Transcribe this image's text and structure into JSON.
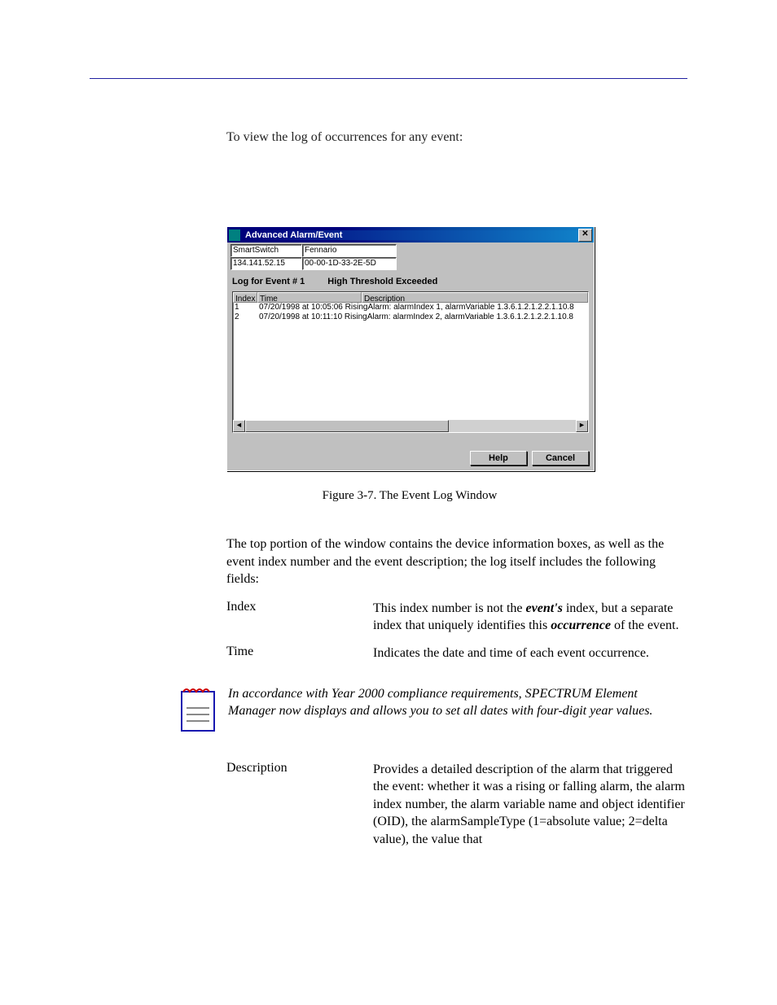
{
  "intro": "To view the log of occurrences for any event:",
  "window": {
    "title": "Advanced Alarm/Event",
    "info": {
      "device_name": "SmartSwitch",
      "location": "Fennario",
      "ip": "134.141.52.15",
      "mac": "00-00-1D-33-2E-5D"
    },
    "log_label": "Log for Event # 1",
    "log_desc": "High Threshold Exceeded",
    "columns": {
      "index": "Index",
      "time": "Time",
      "description": "Description"
    },
    "rows": [
      {
        "idx": "1",
        "rest": "07/20/1998 at 10:05:06  RisingAlarm: alarmIndex 1, alarmVariable 1.3.6.1.2.1.2.2.1.10.8"
      },
      {
        "idx": "2",
        "rest": "07/20/1998 at 10:11:10  RisingAlarm: alarmIndex 2, alarmVariable 1.3.6.1.2.1.2.2.1.10.8"
      }
    ],
    "buttons": {
      "help": "Help",
      "cancel": "Cancel"
    }
  },
  "figure_caption": "Figure 3-7. The Event Log Window",
  "para1": "The top portion of the window contains the device information boxes, as well as the event index number and the event description; the log itself includes the following fields:",
  "defs": {
    "index": {
      "term": "Index",
      "pre": "This index number is not the ",
      "em1": "event's",
      "mid": " index, but a separate index that uniquely identifies this ",
      "em2": "occurrence",
      "post": " of the event."
    },
    "time": {
      "term": "Time",
      "body": "Indicates the date and time of each event occurrence."
    },
    "description": {
      "term": "Description",
      "body": "Provides a detailed description of the alarm that triggered the event: whether it was a rising or falling alarm, the alarm index number, the alarm variable name and object identifier (OID), the alarmSampleType (1=absolute value; 2=delta value), the value that"
    }
  },
  "note": "In accordance with Year 2000 compliance requirements, SPECTRUM Element Manager now displays and allows you to set all dates with four-digit year values."
}
